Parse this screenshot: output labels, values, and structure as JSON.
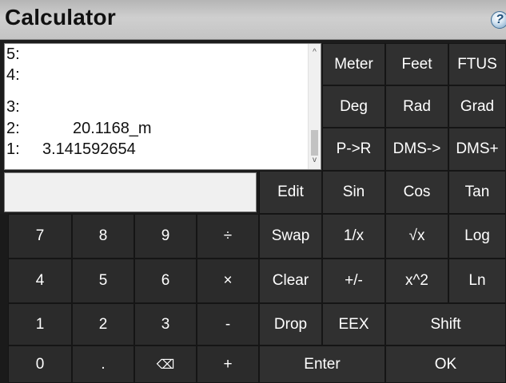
{
  "window": {
    "title": "Calculator",
    "help_glyph": "?"
  },
  "stack": {
    "rows": [
      {
        "label": "5:",
        "value": ""
      },
      {
        "label": "4:",
        "value": ""
      },
      {
        "label": "3:",
        "value": ""
      },
      {
        "label": "2:",
        "value": "20.1168_m"
      },
      {
        "label": "1:",
        "value": "3.141592654"
      }
    ],
    "scroll_up": "^",
    "scroll_down": "v"
  },
  "entry": {
    "value": ""
  },
  "units_row": [
    "Meter",
    "Feet",
    "FTUS"
  ],
  "angle_row": [
    "Deg",
    "Rad",
    "Grad"
  ],
  "conv_row": [
    "P->R",
    "DMS->",
    "DMS+"
  ],
  "func_row": [
    "Edit",
    "Sin",
    "Cos",
    "Tan"
  ],
  "row7": [
    "7",
    "8",
    "9",
    "÷",
    "Swap",
    "1/x",
    "√x",
    "Log"
  ],
  "row4": [
    "4",
    "5",
    "6",
    "×",
    "Clear",
    "+/-",
    "x^2",
    "Ln"
  ],
  "row1": [
    "1",
    "2",
    "3",
    "-",
    "Drop",
    "EEX",
    "Shift"
  ],
  "row0": [
    "0",
    ".",
    "⌫",
    "+",
    "Enter",
    "OK"
  ]
}
